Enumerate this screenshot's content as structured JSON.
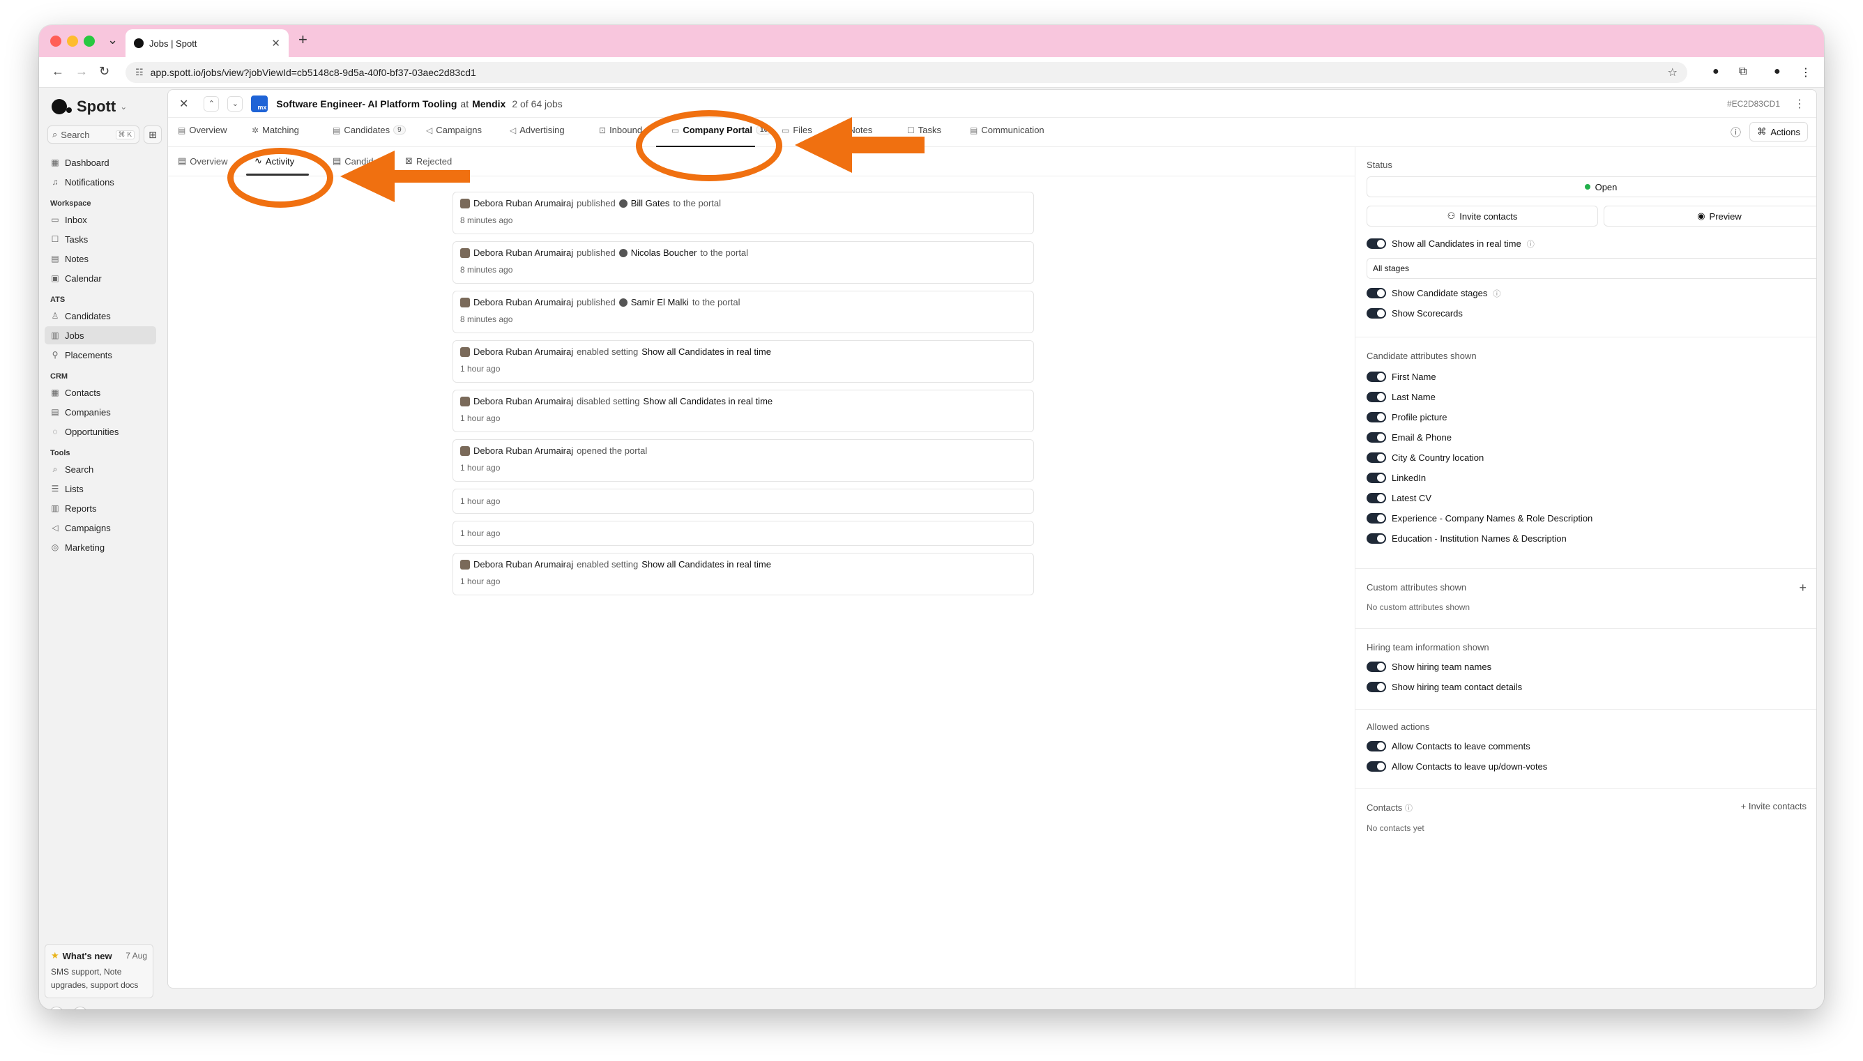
{
  "browser": {
    "tab_title": "Jobs | Spott",
    "url": "app.spott.io/jobs/view?jobViewId=cb5148c8-9d5a-40f0-bf37-03aec2d83cd1"
  },
  "sidebar": {
    "brand": "Spott",
    "search_label": "Search",
    "search_shortcut": "⌘ K",
    "items_top": [
      {
        "label": "Dashboard",
        "icon": "grid-icon"
      },
      {
        "label": "Notifications",
        "icon": "bell-icon"
      }
    ],
    "groups": [
      {
        "title": "Workspace",
        "items": [
          {
            "label": "Inbox",
            "icon": "inbox-icon"
          },
          {
            "label": "Tasks",
            "icon": "checkbox-icon"
          },
          {
            "label": "Notes",
            "icon": "note-icon"
          },
          {
            "label": "Calendar",
            "icon": "calendar-icon"
          }
        ]
      },
      {
        "title": "ATS",
        "items": [
          {
            "label": "Candidates",
            "icon": "person-icon"
          },
          {
            "label": "Jobs",
            "icon": "briefcase-icon",
            "active": true
          },
          {
            "label": "Placements",
            "icon": "placement-icon"
          }
        ]
      },
      {
        "title": "CRM",
        "items": [
          {
            "label": "Contacts",
            "icon": "contacts-icon"
          },
          {
            "label": "Companies",
            "icon": "building-icon"
          },
          {
            "label": "Opportunities",
            "icon": "opportunity-icon"
          }
        ]
      },
      {
        "title": "Tools",
        "items": [
          {
            "label": "Search",
            "icon": "search-icon"
          },
          {
            "label": "Lists",
            "icon": "list-icon"
          },
          {
            "label": "Reports",
            "icon": "chart-icon"
          },
          {
            "label": "Campaigns",
            "icon": "megaphone-icon"
          },
          {
            "label": "Marketing",
            "icon": "marketing-icon"
          }
        ]
      }
    ],
    "whats_new": {
      "title": "What's new",
      "date": "7 Aug",
      "body": "SMS support, Note upgrades, support docs"
    }
  },
  "job": {
    "title": "Software Engineer- AI Platform Tooling",
    "at": "at",
    "company": "Mendix",
    "company_logo_text": "mx",
    "position": "2 of 64 jobs",
    "id": "#EC2D83CD1"
  },
  "tabs": [
    {
      "label": "Overview"
    },
    {
      "label": "Matching"
    },
    {
      "label": "Candidates",
      "badge": "9"
    },
    {
      "label": "Campaigns"
    },
    {
      "label": "Advertising"
    },
    {
      "label": "Inbound"
    },
    {
      "label": "Company Portal",
      "badge": "10",
      "active": true
    },
    {
      "label": "Files"
    },
    {
      "label": "Notes"
    },
    {
      "label": "Tasks"
    },
    {
      "label": "Communication"
    }
  ],
  "actions_label": "Actions",
  "subtabs": [
    {
      "label": "Overview"
    },
    {
      "label": "Activity",
      "active": true
    },
    {
      "label": "Candidates"
    },
    {
      "label": "Rejected"
    }
  ],
  "activity": [
    {
      "actor": "Debora Ruban Arumairaj",
      "verb": "published",
      "object": "Bill Gates",
      "suffix": "to the portal",
      "time": "8 minutes ago"
    },
    {
      "actor": "Debora Ruban Arumairaj",
      "verb": "published",
      "object": "Nicolas Boucher",
      "suffix": "to the portal",
      "time": "8 minutes ago"
    },
    {
      "actor": "Debora Ruban Arumairaj",
      "verb": "published",
      "object": "Samir El Malki",
      "suffix": "to the portal",
      "time": "8 minutes ago"
    },
    {
      "actor": "Debora Ruban Arumairaj",
      "verb": "enabled setting",
      "object": "Show all Candidates in real time",
      "suffix": "",
      "time": "1 hour ago"
    },
    {
      "actor": "Debora Ruban Arumairaj",
      "verb": "disabled setting",
      "object": "Show all Candidates in real time",
      "suffix": "",
      "time": "1 hour ago"
    },
    {
      "actor": "Debora Ruban Arumairaj",
      "verb": "opened the portal",
      "object": "",
      "suffix": "",
      "time": "1 hour ago"
    },
    {
      "actor": "",
      "verb": "",
      "object": "",
      "suffix": "",
      "time": "1 hour ago"
    },
    {
      "actor": "",
      "verb": "",
      "object": "",
      "suffix": "",
      "time": "1 hour ago"
    },
    {
      "actor": "Debora Ruban Arumairaj",
      "verb": "enabled setting",
      "object": "Show all Candidates in real time",
      "suffix": "",
      "time": "1 hour ago"
    }
  ],
  "portal": {
    "status_label": "Status",
    "status_value": "Open",
    "invite_label": "Invite contacts",
    "preview_label": "Preview",
    "realtime_label": "Show all Candidates in real time",
    "stages_select": "All stages",
    "show_stages_label": "Show Candidate stages",
    "show_scorecards_label": "Show Scorecards",
    "attributes_title": "Candidate attributes shown",
    "attributes": [
      "First Name",
      "Last Name",
      "Profile picture",
      "Email & Phone",
      "City & Country location",
      "LinkedIn",
      "Latest CV",
      "Experience - Company Names & Role Description",
      "Education - Institution Names & Description"
    ],
    "custom_title": "Custom attributes shown",
    "custom_empty": "No custom attributes shown",
    "hiring_title": "Hiring team information shown",
    "hiring_items": [
      "Show hiring team names",
      "Show hiring team contact details"
    ],
    "allowed_title": "Allowed actions",
    "allowed_items": [
      "Allow Contacts to leave comments",
      "Allow Contacts to leave up/down-votes"
    ],
    "contacts_title": "Contacts",
    "contacts_invite": "Invite contacts",
    "contacts_empty": "No contacts yet"
  },
  "colors": {
    "annotation": "#f07010",
    "tabstrip": "#f8c6dd",
    "status_green": "#22b04b"
  }
}
